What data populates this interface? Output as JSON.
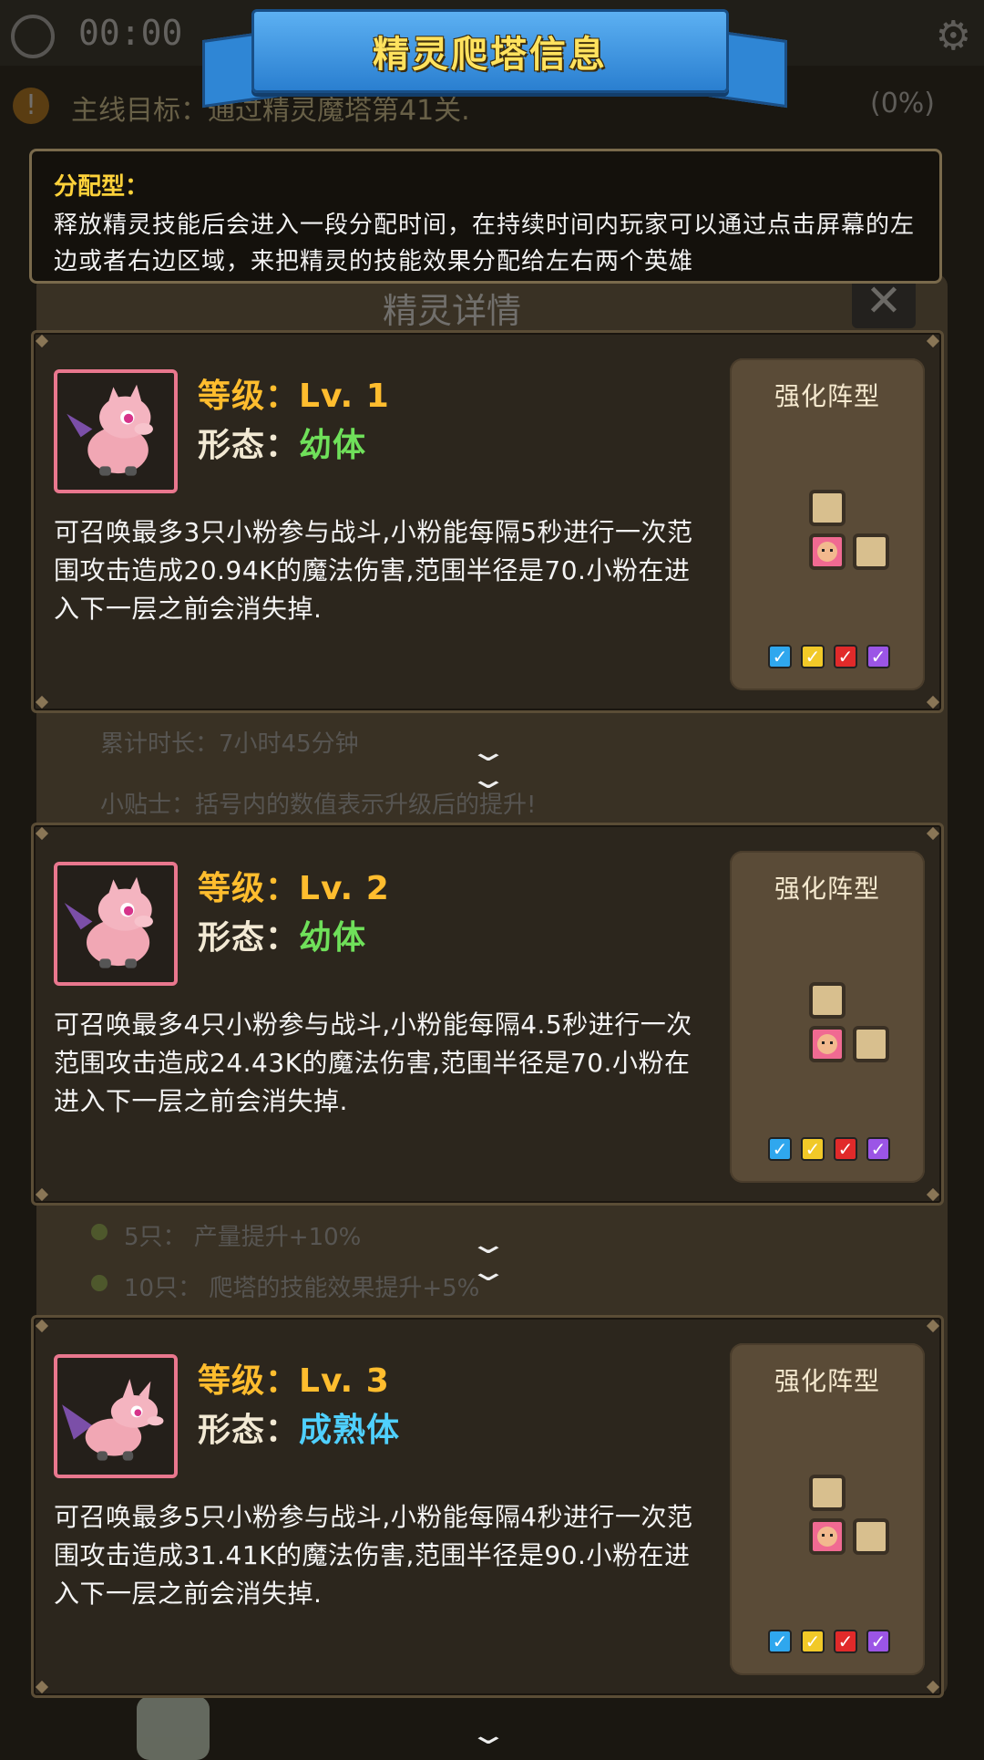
{
  "background": {
    "timer": "00:00",
    "goal_text": "主线目标：通过精灵魔塔第41关.",
    "goal_progress": "(0%)",
    "panel_title": "精灵详情",
    "close_label": "✕",
    "bg_lines": [
      {
        "text": "累计时长：7小时45分钟",
        "top": 0
      },
      {
        "text": "小贴士：括号内的数值表示升级后的提升!",
        "top": 0
      },
      {
        "text": "5只：  产量提升+10%",
        "top": 0
      },
      {
        "text": "10只：  爬塔的技能效果提升+5%",
        "top": 0
      }
    ]
  },
  "banner": {
    "title": "精灵爬塔信息"
  },
  "info": {
    "title": "分配型：",
    "text": "释放精灵技能后会进入一段分配时间，在持续时间内玩家可以通过点击屏幕的左边或者右边区域，来把精灵的技能效果分配给左右两个英雄"
  },
  "levels": [
    {
      "level_label": "等级：",
      "level_value": "Lv. 1",
      "form_label": "形态：",
      "form_value": "幼体",
      "description": "可召唤最多3只小粉参与战斗,小粉能每隔5秒进行一次范围攻击造成20.94K的魔法伤害,范围半径是70.小粉在进入下一层之前会消失掉.",
      "formation_title": "强化阵型"
    },
    {
      "level_label": "等级：",
      "level_value": "Lv. 2",
      "form_label": "形态：",
      "form_value": "幼体",
      "description": "可召唤最多4只小粉参与战斗,小粉能每隔4.5秒进行一次范围攻击造成24.43K的魔法伤害,范围半径是70.小粉在进入下一层之前会消失掉.",
      "formation_title": "强化阵型"
    },
    {
      "level_label": "等级：",
      "level_value": "Lv. 3",
      "form_label": "形态：",
      "form_value": "成熟体",
      "description": "可召唤最多5只小粉参与战斗,小粉能每隔4秒进行一次范围攻击造成31.41K的魔法伤害,范围半径是90.小粉在进入下一层之前会消失掉.",
      "formation_title": "强化阵型"
    }
  ],
  "colors": {
    "level_text": "#ffbd2e",
    "form_young": "#6fe05a",
    "form_mature": "#4fd0ff",
    "info_title": "#ffd23a",
    "banner_text": "#ffe25e"
  }
}
